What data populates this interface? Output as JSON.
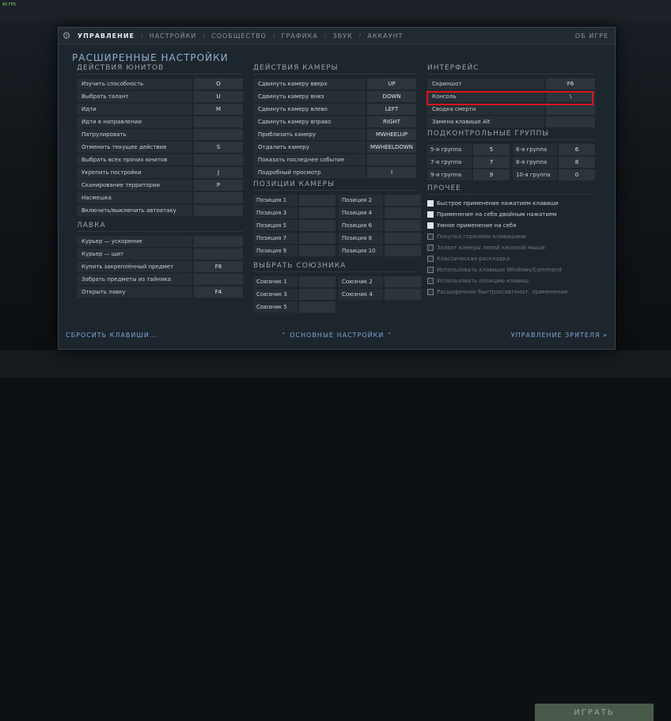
{
  "hud": {
    "fps": "60 FPS",
    "play_label": "ИГРАТЬ"
  },
  "tabs": [
    {
      "label": "УПРАВЛЕНИЕ",
      "active": true
    },
    {
      "label": "НАСТРОЙКИ",
      "active": false
    },
    {
      "label": "СООБЩЕСТВО",
      "active": false
    },
    {
      "label": "ГРАФИКА",
      "active": false
    },
    {
      "label": "ЗВУК",
      "active": false
    },
    {
      "label": "АККАУНТ",
      "active": false
    }
  ],
  "about": "ОБ ИГРЕ",
  "title": "РАСШИРЕННЫЕ НАСТРОЙКИ",
  "units": {
    "title": "ДЕЙСТВИЯ ЮНИТОВ",
    "rows": [
      {
        "label": "Изучить способность",
        "key": "O"
      },
      {
        "label": "Выбрать талант",
        "key": "U"
      },
      {
        "label": "Идти",
        "key": "M"
      },
      {
        "label": "Идти в направлении",
        "key": ""
      },
      {
        "label": "Патрулировать",
        "key": ""
      },
      {
        "label": "Отменить текущее действие",
        "key": "S"
      },
      {
        "label": "Выбрать всех прочих юнитов",
        "key": ""
      },
      {
        "label": "Укрепить постройки",
        "key": "J"
      },
      {
        "label": "Сканирование территории",
        "key": "P"
      },
      {
        "label": "Насмешка",
        "key": ""
      },
      {
        "label": "Включить/выключить автоатаку",
        "key": ""
      }
    ]
  },
  "shop": {
    "title": "ЛАВКА",
    "rows": [
      {
        "label": "Курьер — ускорение",
        "key": ""
      },
      {
        "label": "Курьер — щит",
        "key": ""
      },
      {
        "label": "Купить закреплённый предмет",
        "key": "F8"
      },
      {
        "label": "Забрать предметы из тайника",
        "key": ""
      },
      {
        "label": "Открыть лавку",
        "key": "F4"
      }
    ]
  },
  "camera": {
    "title": "ДЕЙСТВИЯ КАМЕРЫ",
    "rows": [
      {
        "label": "Сдвинуть камеру вверх",
        "key": "UP"
      },
      {
        "label": "Сдвинуть камеру вниз",
        "key": "DOWN"
      },
      {
        "label": "Сдвинуть камеру влево",
        "key": "LEFT"
      },
      {
        "label": "Сдвинуть камеру вправо",
        "key": "RIGHT"
      },
      {
        "label": "Приблизить камеру",
        "key": "MWHEELUP"
      },
      {
        "label": "Отдалить камеру",
        "key": "MWHEELDOWN"
      },
      {
        "label": "Показать последнее событие",
        "key": ""
      },
      {
        "label": "Подробный просмотр",
        "key": "I"
      }
    ]
  },
  "positions": {
    "title": "ПОЗИЦИИ КАМЕРЫ",
    "items": [
      {
        "label": "Позиция 1",
        "key": ""
      },
      {
        "label": "Позиция 2",
        "key": ""
      },
      {
        "label": "Позиция 3",
        "key": ""
      },
      {
        "label": "Позиция 4",
        "key": ""
      },
      {
        "label": "Позиция 5",
        "key": ""
      },
      {
        "label": "Позиция 6",
        "key": ""
      },
      {
        "label": "Позиция 7",
        "key": ""
      },
      {
        "label": "Позиция 8",
        "key": ""
      },
      {
        "label": "Позиция 9",
        "key": ""
      },
      {
        "label": "Позиция 10",
        "key": ""
      }
    ]
  },
  "allies": {
    "title": "ВЫБРАТЬ СОЮЗНИКА",
    "items": [
      {
        "label": "Союзник 1",
        "key": ""
      },
      {
        "label": "Союзник 2",
        "key": ""
      },
      {
        "label": "Союзник 3",
        "key": ""
      },
      {
        "label": "Союзник 4",
        "key": ""
      },
      {
        "label": "Союзник 5",
        "key": ""
      }
    ]
  },
  "interface": {
    "title": "ИНТЕРФЕЙС",
    "rows": [
      {
        "label": "Скриншот",
        "key": "F6"
      },
      {
        "label": "Консоль",
        "key": "\\"
      },
      {
        "label": "Сводка смерти",
        "key": ""
      },
      {
        "label": "Замена клавише Alt",
        "key": ""
      }
    ]
  },
  "groups": {
    "title": "ПОДКОНТРОЛЬНЫЕ ГРУППЫ",
    "items": [
      {
        "label": "5-я группа",
        "key": "5"
      },
      {
        "label": "6-я группа",
        "key": "6"
      },
      {
        "label": "7-я группа",
        "key": "7"
      },
      {
        "label": "8-я группа",
        "key": "8"
      },
      {
        "label": "9-я группа",
        "key": "9"
      },
      {
        "label": "10-я группа",
        "key": "0"
      }
    ]
  },
  "other": {
    "title": "ПРОЧЕЕ",
    "items": [
      {
        "label": "Быстрое применение нажатием клавиши",
        "checked": true
      },
      {
        "label": "Применение на себя двойным нажатием",
        "checked": true
      },
      {
        "label": "Умное применение на себя",
        "checked": true
      },
      {
        "label": "Покупка горячими клавишами",
        "checked": false
      },
      {
        "label": "Захват камеры левой кнопкой мыши",
        "checked": false
      },
      {
        "label": "Классическая раскладка",
        "checked": false
      },
      {
        "label": "Использовать клавиши Windows/Command",
        "checked": false
      },
      {
        "label": "Использовать позицию клавиш",
        "checked": false
      },
      {
        "label": "Расширенное быстрое/автомат. применение",
        "checked": false
      }
    ]
  },
  "footer": {
    "reset": "СБРОСИТЬ КЛАВИШИ...",
    "basic": "⌃ ОСНОВНЫЕ НАСТРОЙКИ ⌃",
    "spectator": "УПРАВЛЕНИЕ ЗРИТЕЛЯ »"
  }
}
